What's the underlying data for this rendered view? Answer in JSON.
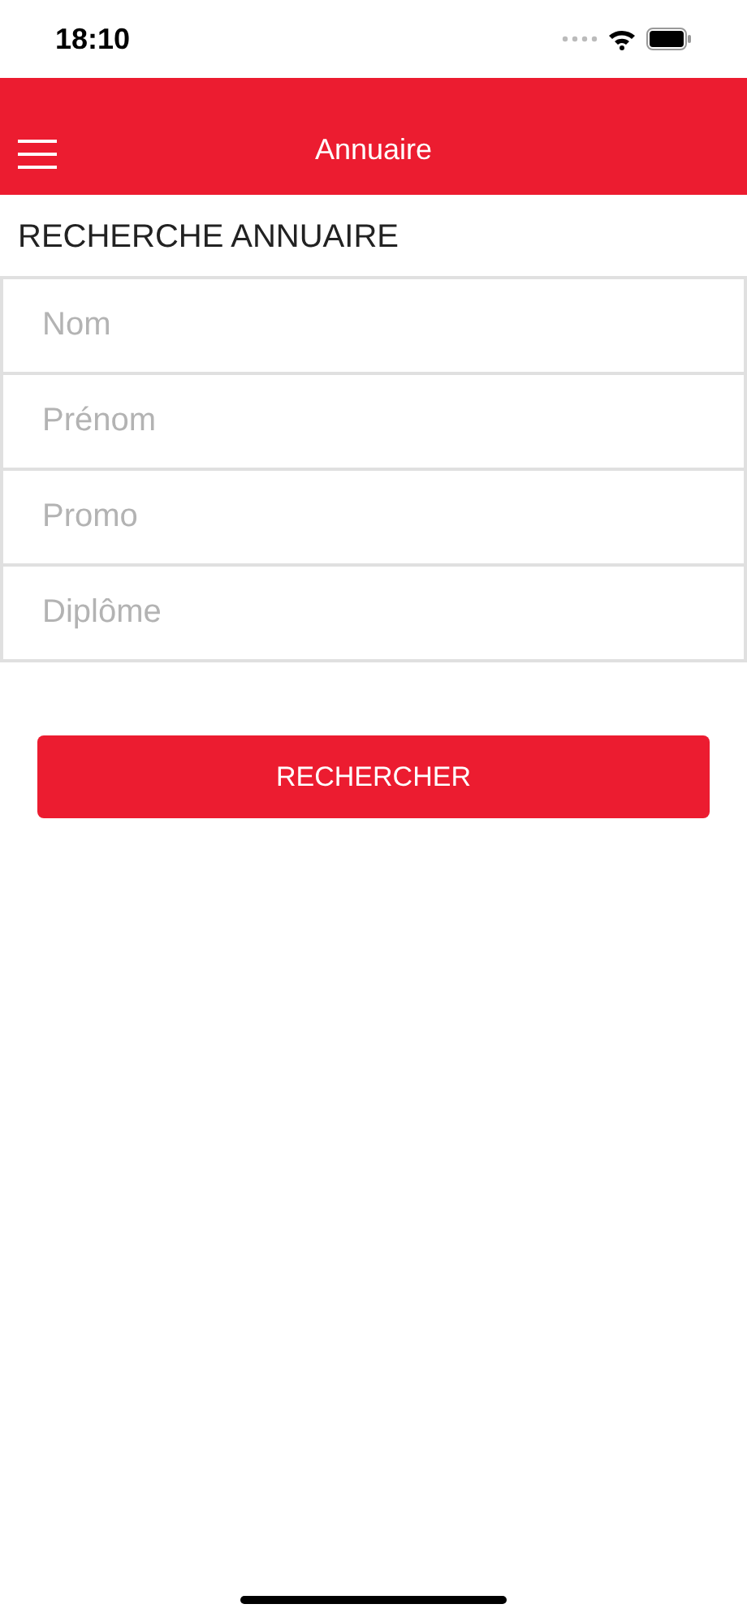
{
  "status_bar": {
    "time": "18:10"
  },
  "header": {
    "title": "Annuaire"
  },
  "section_title": "RECHERCHE ANNUAIRE",
  "fields": [
    {
      "placeholder": "Nom"
    },
    {
      "placeholder": "Prénom"
    },
    {
      "placeholder": "Promo"
    },
    {
      "placeholder": "Diplôme"
    }
  ],
  "search_button": "RECHERCHER"
}
